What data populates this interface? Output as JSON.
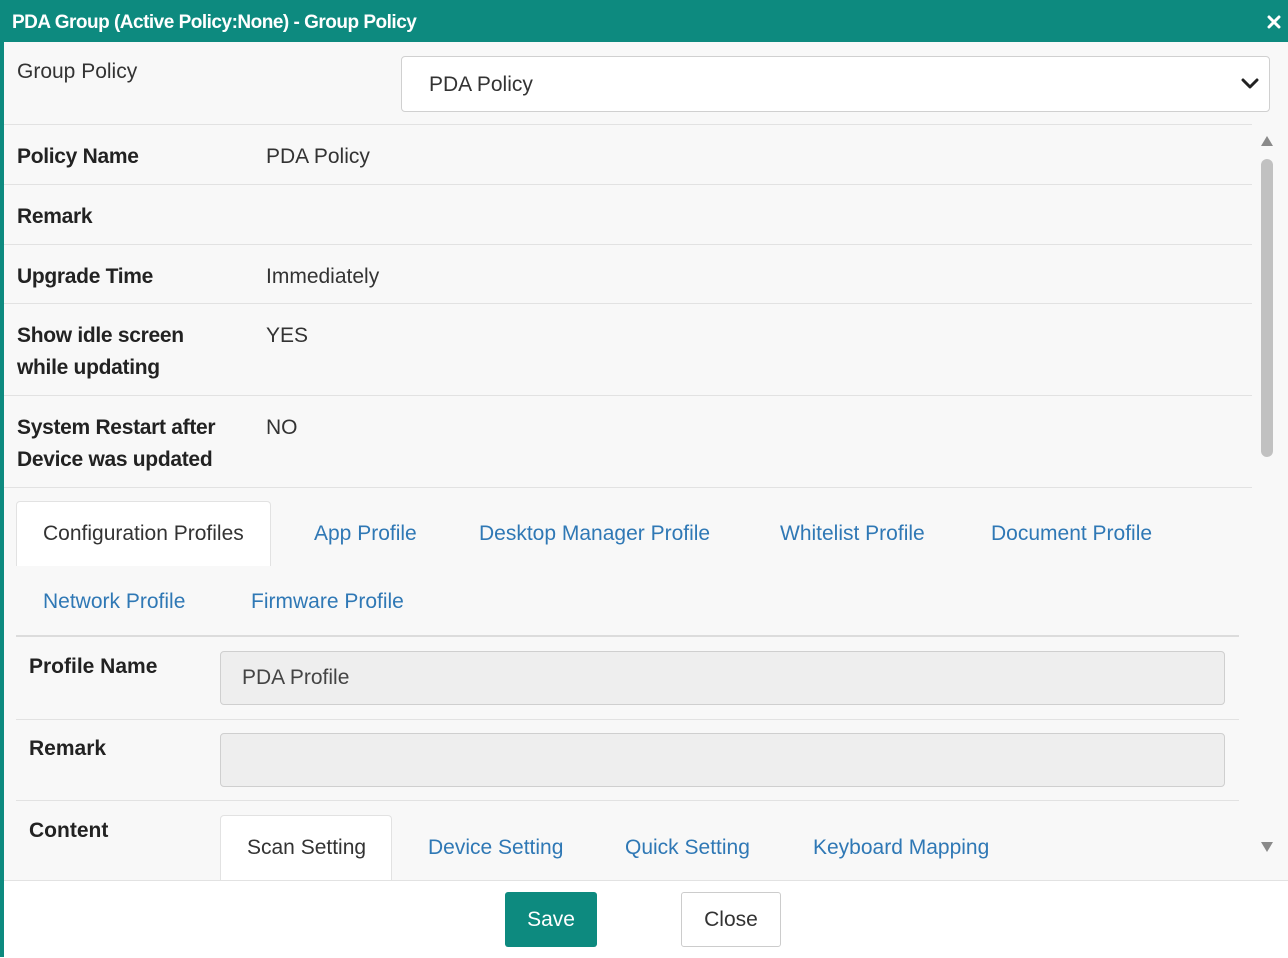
{
  "titlebar": {
    "title": "PDA Group (Active Policy:None) - Group Policy",
    "close_icon": "close-icon"
  },
  "group_policy": {
    "label": "Group Policy",
    "selected": "PDA Policy"
  },
  "policy_info": [
    {
      "label": "Policy Name",
      "value": "PDA Policy"
    },
    {
      "label": "Remark",
      "value": ""
    },
    {
      "label": "Upgrade Time",
      "value": "Immediately"
    },
    {
      "label": "Show idle screen while updating",
      "value": "YES"
    },
    {
      "label": "System Restart after Device was updated",
      "value": "NO"
    }
  ],
  "profile_tabs": [
    "Configuration Profiles",
    "App Profile",
    "Desktop Manager Profile",
    "Whitelist Profile",
    "Document Profile",
    "Network Profile",
    "Firmware Profile"
  ],
  "active_profile_tab": "Configuration Profiles",
  "profile": {
    "name_label": "Profile Name",
    "name_value": "PDA Profile",
    "remark_label": "Remark",
    "remark_value": "",
    "content_label": "Content"
  },
  "content_tabs": [
    "Scan Setting",
    "Device Setting",
    "Quick Setting",
    "Keyboard Mapping"
  ],
  "active_content_tab": "Scan Setting",
  "footer": {
    "save_label": "Save",
    "close_label": "Close"
  },
  "colors": {
    "accent": "#0d8a7f",
    "link": "#2f78b5"
  }
}
